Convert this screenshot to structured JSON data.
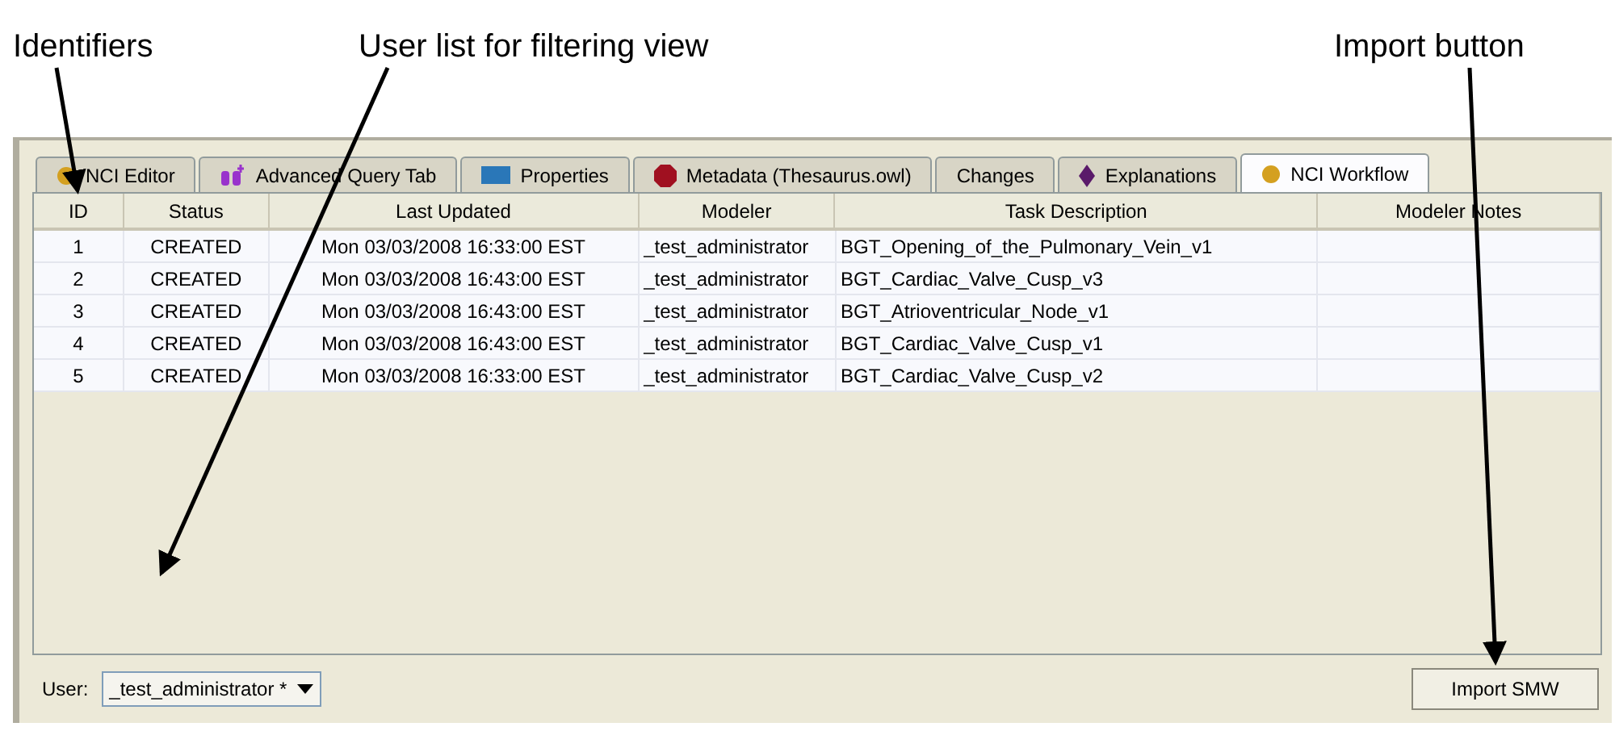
{
  "annotations": [
    {
      "label": "Identifiers"
    },
    {
      "label": "User list for filtering view"
    },
    {
      "label": "Import button"
    }
  ],
  "tabs": [
    {
      "label": "NCI Editor",
      "kind": "circle",
      "selected": false
    },
    {
      "label": "Advanced Query Tab",
      "kind": "binoculars",
      "selected": false
    },
    {
      "label": "Properties",
      "kind": "square",
      "selected": false
    },
    {
      "label": "Metadata (Thesaurus.owl)",
      "kind": "hexagon",
      "selected": false
    },
    {
      "label": "Changes",
      "kind": "plain",
      "selected": false
    },
    {
      "label": "Explanations",
      "kind": "diamond",
      "selected": false
    },
    {
      "label": "NCI Workflow",
      "kind": "circle",
      "selected": true
    }
  ],
  "table": {
    "columns": [
      "ID",
      "Status",
      "Last Updated",
      "Modeler",
      "Task Description",
      "Modeler Notes"
    ],
    "rows": [
      [
        "1",
        "CREATED",
        "Mon 03/03/2008 16:33:00 EST",
        "_test_administrator",
        "BGT_Opening_of_the_Pulmonary_Vein_v1",
        ""
      ],
      [
        "2",
        "CREATED",
        "Mon 03/03/2008 16:43:00 EST",
        "_test_administrator",
        "BGT_Cardiac_Valve_Cusp_v3",
        ""
      ],
      [
        "3",
        "CREATED",
        "Mon 03/03/2008 16:43:00 EST",
        "_test_administrator",
        "BGT_Atrioventricular_Node_v1",
        ""
      ],
      [
        "4",
        "CREATED",
        "Mon 03/03/2008 16:43:00 EST",
        "_test_administrator",
        "BGT_Cardiac_Valve_Cusp_v1",
        ""
      ],
      [
        "5",
        "CREATED",
        "Mon 03/03/2008 16:33:00 EST",
        "_test_administrator",
        "BGT_Cardiac_Valve_Cusp_v2",
        ""
      ]
    ]
  },
  "user_filter": {
    "label": "User:",
    "value": "_test_administrator *"
  },
  "import_button": "Import SMW"
}
